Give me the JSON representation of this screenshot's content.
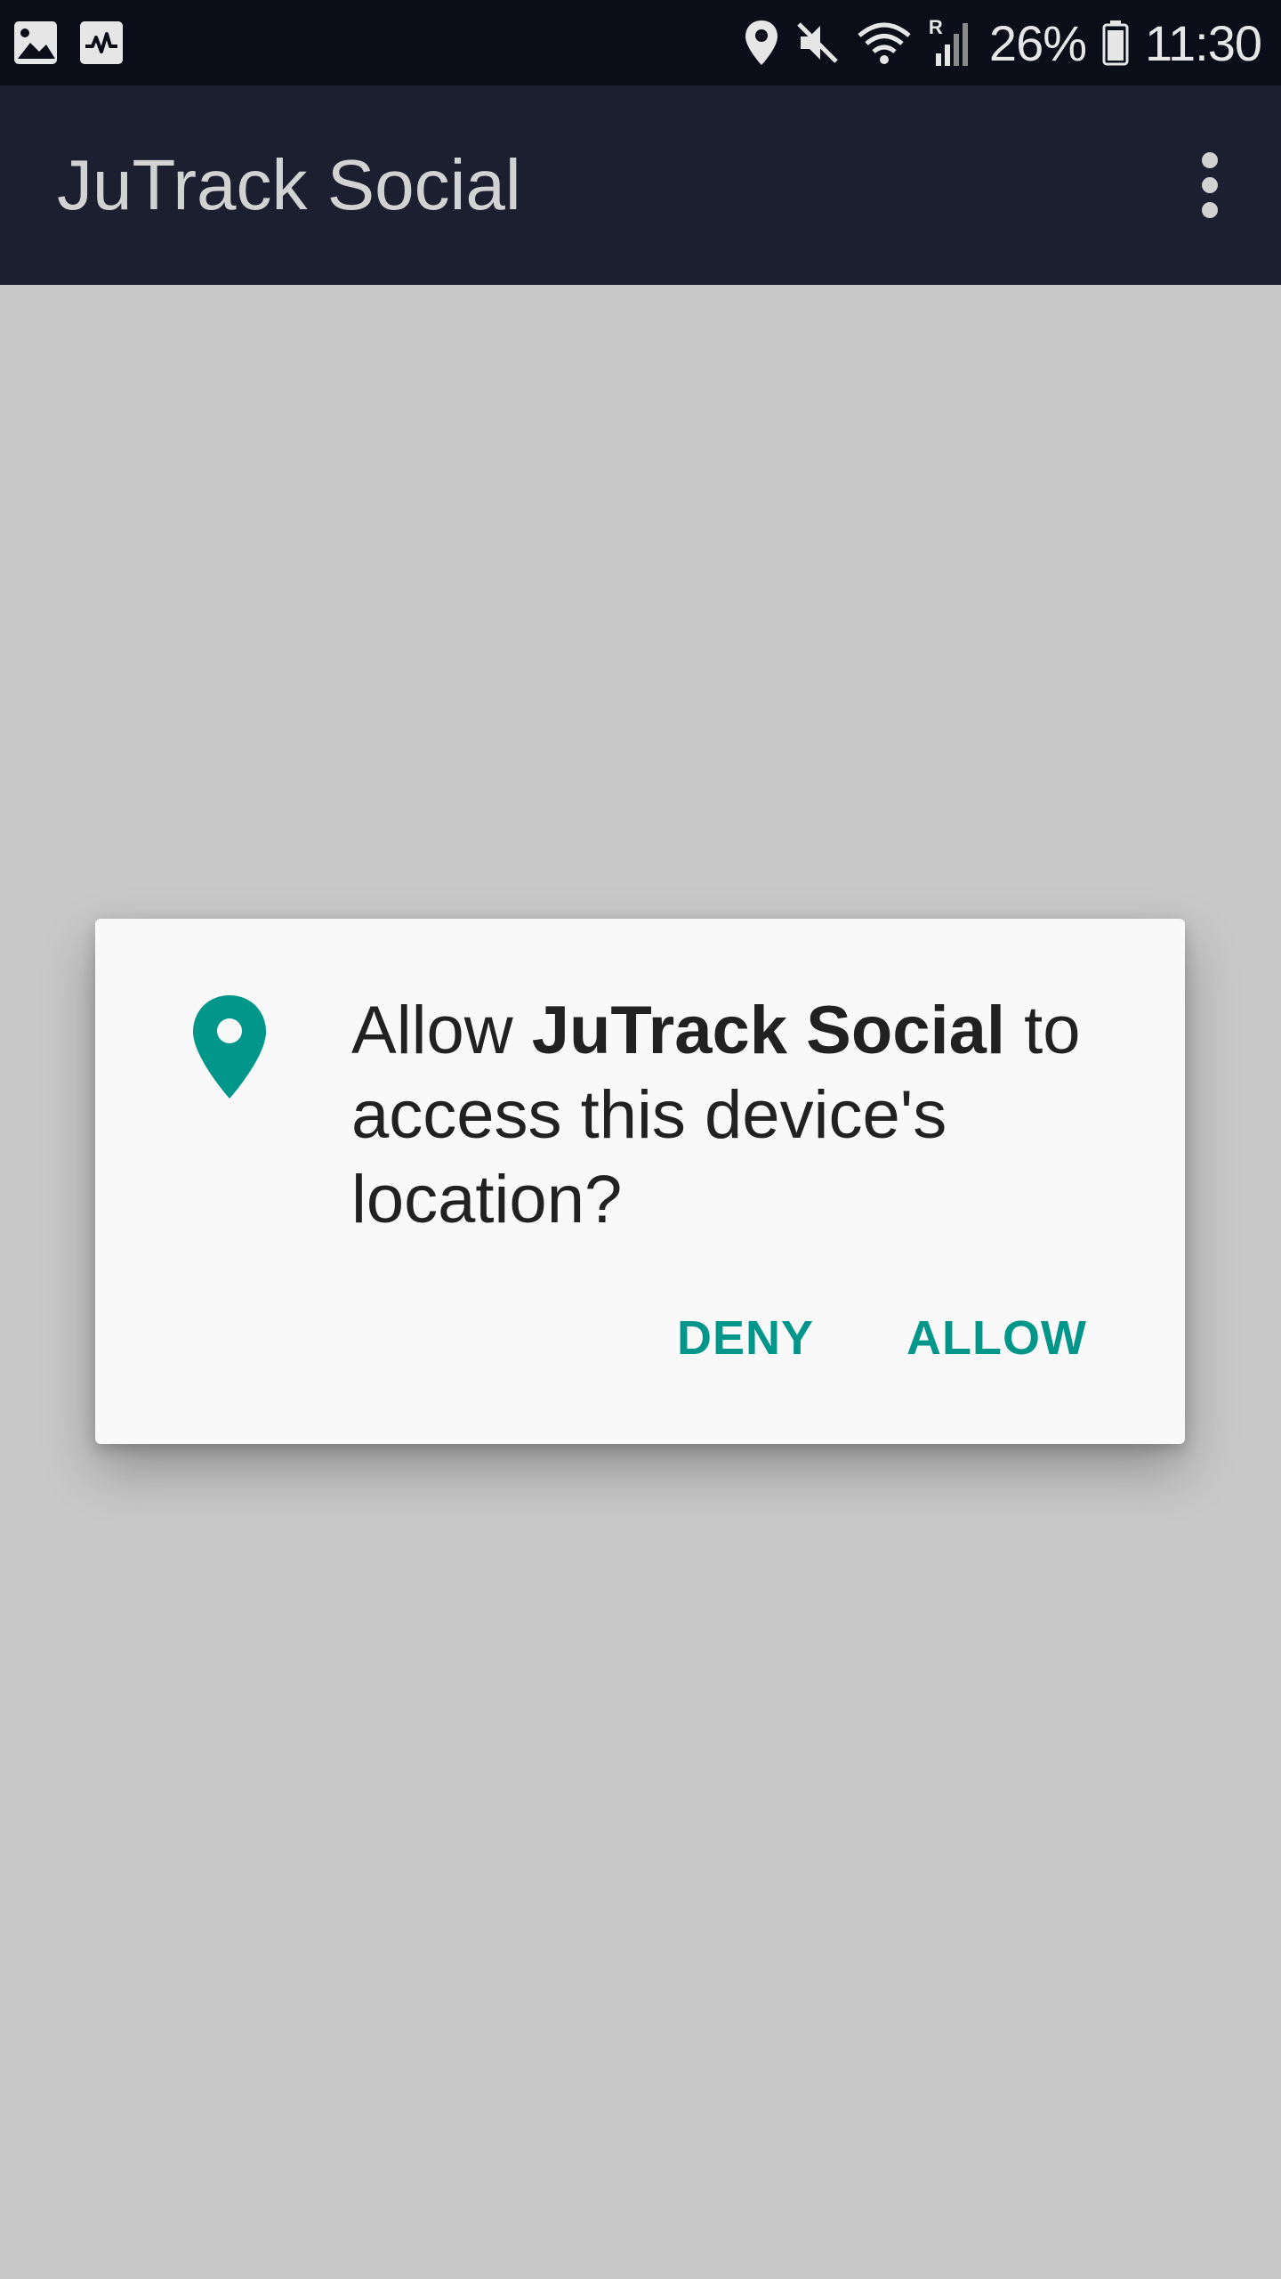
{
  "status_bar": {
    "battery": "26%",
    "time": "11:30",
    "network_indicator": "R",
    "icons": [
      "gallery-icon",
      "activity-icon",
      "location-icon",
      "mute-icon",
      "wifi-icon",
      "signal-icon",
      "battery-icon"
    ]
  },
  "app_bar": {
    "title": "JuTrack Social",
    "menu_icon": "overflow-menu-icon"
  },
  "dialog": {
    "icon": "location-pin-icon",
    "message_prefix": "Allow ",
    "app_name": "JuTrack Social",
    "message_suffix": " to access this device's location?",
    "deny_label": "DENY",
    "allow_label": "ALLOW"
  },
  "colors": {
    "status_bar_bg": "#0b0e18",
    "app_bar_bg": "#1b1f30",
    "scrim_bg": "#c8c8c8",
    "dialog_bg": "#f9f9f9",
    "accent": "#00968a"
  }
}
